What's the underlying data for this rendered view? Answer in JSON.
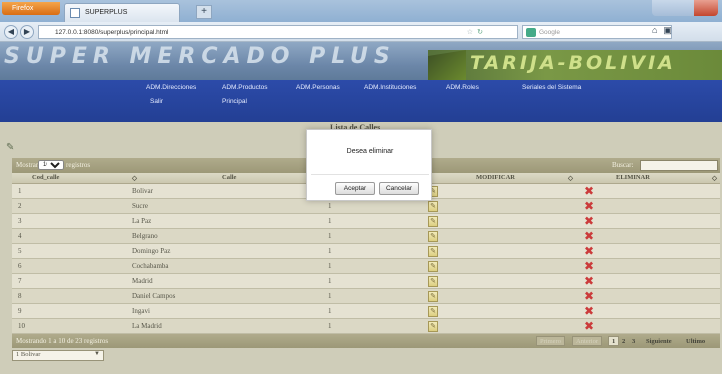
{
  "browser": {
    "menu_label": "Firefox",
    "tab_title": "SUPERPLUS",
    "new_tab": "+",
    "url": "127.0.0.1:8080/superplus/principal.html",
    "search_placeholder": "Google"
  },
  "banner": {
    "title": "SUPER MERCADO PLUS",
    "subtitle": "TARIJA-BOLIVIA"
  },
  "menu": {
    "items": [
      "ADM.Direcciones",
      "ADM.Productos",
      "ADM.Personas",
      "ADM.Instituciones",
      "ADM.Roles",
      "Seriales del Sistema",
      "Salir",
      "Principal"
    ]
  },
  "page": {
    "heading": "Lista de Calles"
  },
  "table": {
    "show_label": "Mostrar",
    "page_size": "10",
    "records_label": "registros",
    "search_label": "Buscar:",
    "search_value": "",
    "columns": [
      "Cod_calle",
      "Calle",
      "",
      "MODIFICAR",
      "ELIMINAR"
    ],
    "rows": [
      {
        "id": "1",
        "name": "Bolivar",
        "num": "1"
      },
      {
        "id": "2",
        "name": "Sucre",
        "num": "1"
      },
      {
        "id": "3",
        "name": "La Paz",
        "num": "1"
      },
      {
        "id": "4",
        "name": "Belgrano",
        "num": "1"
      },
      {
        "id": "5",
        "name": "Domingo Paz",
        "num": "1"
      },
      {
        "id": "6",
        "name": "Cochabamba",
        "num": "1"
      },
      {
        "id": "7",
        "name": "Madrid",
        "num": "1"
      },
      {
        "id": "8",
        "name": "Daniel Campos",
        "num": "1"
      },
      {
        "id": "9",
        "name": "Ingavi",
        "num": "1"
      },
      {
        "id": "10",
        "name": "La Madrid",
        "num": "1"
      }
    ],
    "info": "Mostrando 1 a 10 de 23 registros",
    "pagination": {
      "first": "Primero",
      "previous": "Anterior",
      "pages": [
        "1",
        "2",
        "3"
      ],
      "active_page": "1",
      "next": "Siguiente",
      "last": "Ultimo"
    }
  },
  "bottom_select": {
    "value": "1 Bolivar"
  },
  "dialog": {
    "message": "Desea eliminar",
    "ok_label": "Aceptar",
    "cancel_label": "Cancelar"
  },
  "colors": {
    "menu_bg": "#2c4ba9",
    "delete_icon": "#c42020",
    "table_header": "#a5a07c"
  }
}
